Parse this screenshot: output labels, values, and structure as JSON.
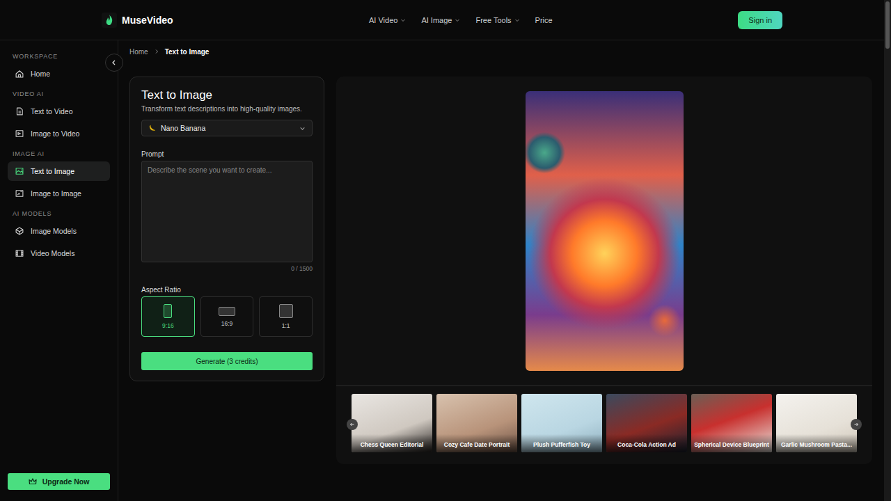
{
  "brand": {
    "name": "MuseVideo"
  },
  "nav": [
    {
      "label": "AI Video",
      "dropdown": true
    },
    {
      "label": "AI Image",
      "dropdown": true
    },
    {
      "label": "Free Tools",
      "dropdown": true
    },
    {
      "label": "Price",
      "dropdown": false
    }
  ],
  "sign_in": "Sign in",
  "sidebar": {
    "sections": [
      {
        "title": "WORKSPACE",
        "items": [
          {
            "label": "Home",
            "selected": false
          }
        ]
      },
      {
        "title": "VIDEO AI",
        "items": [
          {
            "label": "Text to Video",
            "selected": false
          },
          {
            "label": "Image to Video",
            "selected": false
          }
        ]
      },
      {
        "title": "IMAGE AI",
        "items": [
          {
            "label": "Text to Image",
            "selected": true
          },
          {
            "label": "Image to Image",
            "selected": false
          }
        ]
      },
      {
        "title": "AI MODELS",
        "items": [
          {
            "label": "Image Models",
            "selected": false
          },
          {
            "label": "Video Models",
            "selected": false
          }
        ]
      }
    ],
    "upgrade": "Upgrade Now"
  },
  "breadcrumb": [
    "Home",
    "Text to Image"
  ],
  "form": {
    "title": "Text to Image",
    "subtitle": "Transform text descriptions into high-quality images.",
    "model": "Nano Banana",
    "prompt_label": "Prompt",
    "prompt_placeholder": "Describe the scene you want to create...",
    "counter": "0 / 1500",
    "aspect_label": "Aspect Ratio",
    "aspect_ratios": [
      {
        "label": "9:16",
        "selected": true
      },
      {
        "label": "16:9",
        "selected": false
      },
      {
        "label": "1:1",
        "selected": false
      }
    ],
    "generate": "Generate (3 credits)"
  },
  "gallery": [
    {
      "label": "Chess Queen Editorial"
    },
    {
      "label": "Cozy Cafe Date Portrait"
    },
    {
      "label": "Plush Pufferfish Toy"
    },
    {
      "label": "Coca-Cola Action Ad"
    },
    {
      "label": "Spherical Device Blueprint"
    },
    {
      "label": "Garlic Mushroom Pasta..."
    }
  ]
}
